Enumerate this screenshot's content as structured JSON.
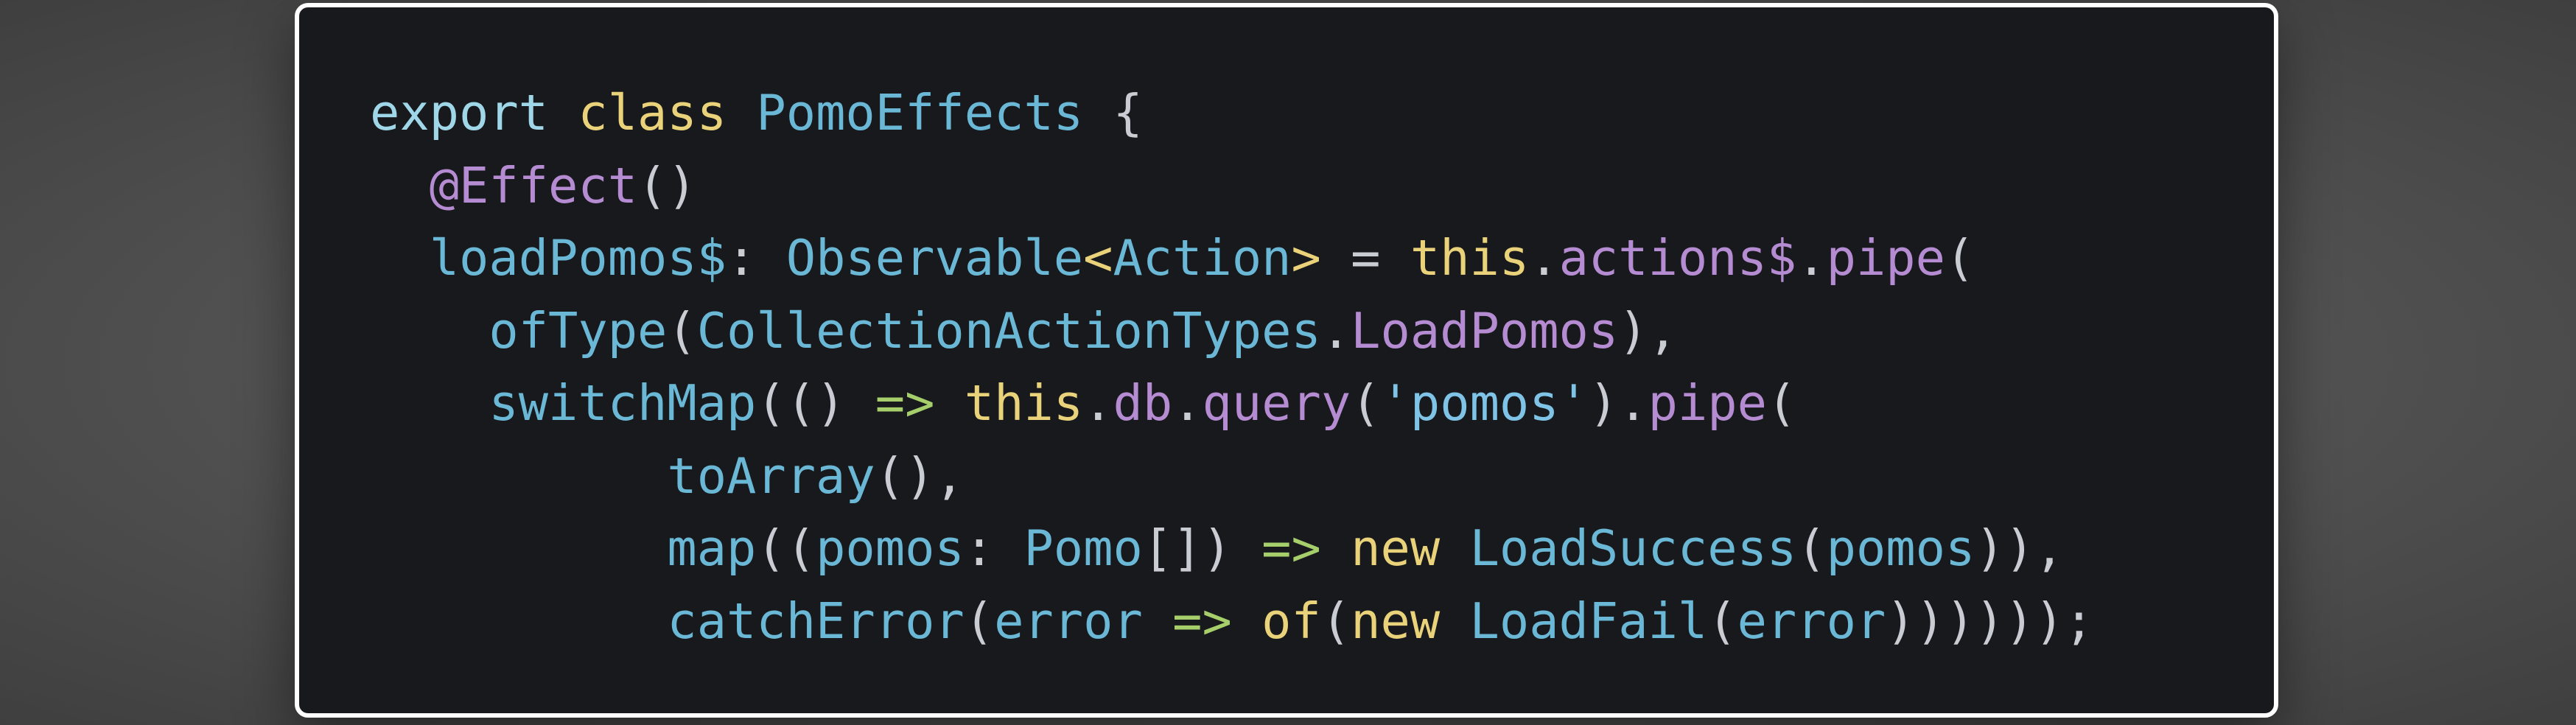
{
  "colors": {
    "background": "#17191c",
    "keyword": "#9fd6e8",
    "keyword_alt": "#e9d27a",
    "type": "#6ab8d6",
    "property": "#b58bd2",
    "punctuation": "#c9cdd3",
    "arrow": "#a6cf6b",
    "string": "#7fc3e6"
  },
  "code": {
    "lines": [
      [
        {
          "text": "export ",
          "k": "kw"
        },
        {
          "text": "class ",
          "k": "kw2"
        },
        {
          "text": "PomoEffects",
          "k": "type"
        },
        {
          "text": " {",
          "k": "punc"
        }
      ],
      [
        {
          "text": "  ",
          "k": "punc"
        },
        {
          "text": "@Effect",
          "k": "deco"
        },
        {
          "text": "()",
          "k": "punc"
        }
      ],
      [
        {
          "text": "  ",
          "k": "punc"
        },
        {
          "text": "loadPomos$",
          "k": "type"
        },
        {
          "text": ": ",
          "k": "punc"
        },
        {
          "text": "Observable",
          "k": "type"
        },
        {
          "text": "<",
          "k": "kw2"
        },
        {
          "text": "Action",
          "k": "type"
        },
        {
          "text": ">",
          "k": "kw2"
        },
        {
          "text": " = ",
          "k": "punc"
        },
        {
          "text": "this",
          "k": "kw2"
        },
        {
          "text": ".",
          "k": "punc"
        },
        {
          "text": "actions$",
          "k": "prop"
        },
        {
          "text": ".",
          "k": "punc"
        },
        {
          "text": "pipe",
          "k": "prop"
        },
        {
          "text": "(",
          "k": "punc"
        }
      ],
      [
        {
          "text": "    ",
          "k": "punc"
        },
        {
          "text": "ofType",
          "k": "fn"
        },
        {
          "text": "(",
          "k": "punc"
        },
        {
          "text": "CollectionActionTypes",
          "k": "type"
        },
        {
          "text": ".",
          "k": "punc"
        },
        {
          "text": "LoadPomos",
          "k": "prop"
        },
        {
          "text": "),",
          "k": "punc"
        }
      ],
      [
        {
          "text": "    ",
          "k": "punc"
        },
        {
          "text": "switchMap",
          "k": "fn"
        },
        {
          "text": "(() ",
          "k": "punc"
        },
        {
          "text": "=>",
          "k": "arrow"
        },
        {
          "text": " ",
          "k": "punc"
        },
        {
          "text": "this",
          "k": "kw2"
        },
        {
          "text": ".",
          "k": "punc"
        },
        {
          "text": "db",
          "k": "prop"
        },
        {
          "text": ".",
          "k": "punc"
        },
        {
          "text": "query",
          "k": "prop"
        },
        {
          "text": "(",
          "k": "punc"
        },
        {
          "text": "'pomos'",
          "k": "str"
        },
        {
          "text": ").",
          "k": "punc"
        },
        {
          "text": "pipe",
          "k": "prop"
        },
        {
          "text": "(",
          "k": "punc"
        }
      ],
      [
        {
          "text": "          ",
          "k": "punc"
        },
        {
          "text": "toArray",
          "k": "fn"
        },
        {
          "text": "(),",
          "k": "punc"
        }
      ],
      [
        {
          "text": "          ",
          "k": "punc"
        },
        {
          "text": "map",
          "k": "fn"
        },
        {
          "text": "((",
          "k": "punc"
        },
        {
          "text": "pomos",
          "k": "type"
        },
        {
          "text": ": ",
          "k": "punc"
        },
        {
          "text": "Pomo",
          "k": "type"
        },
        {
          "text": "[]) ",
          "k": "punc"
        },
        {
          "text": "=>",
          "k": "arrow"
        },
        {
          "text": " ",
          "k": "punc"
        },
        {
          "text": "new ",
          "k": "kw2"
        },
        {
          "text": "LoadSuccess",
          "k": "type"
        },
        {
          "text": "(",
          "k": "punc"
        },
        {
          "text": "pomos",
          "k": "type"
        },
        {
          "text": ")),",
          "k": "punc"
        }
      ],
      [
        {
          "text": "          ",
          "k": "punc"
        },
        {
          "text": "catchError",
          "k": "fn"
        },
        {
          "text": "(",
          "k": "punc"
        },
        {
          "text": "error",
          "k": "type"
        },
        {
          "text": " ",
          "k": "punc"
        },
        {
          "text": "=>",
          "k": "arrow"
        },
        {
          "text": " ",
          "k": "punc"
        },
        {
          "text": "of",
          "k": "kw2"
        },
        {
          "text": "(",
          "k": "punc"
        },
        {
          "text": "new ",
          "k": "kw2"
        },
        {
          "text": "LoadFail",
          "k": "type"
        },
        {
          "text": "(",
          "k": "punc"
        },
        {
          "text": "error",
          "k": "type"
        },
        {
          "text": "))))));",
          "k": "punc"
        }
      ]
    ]
  }
}
